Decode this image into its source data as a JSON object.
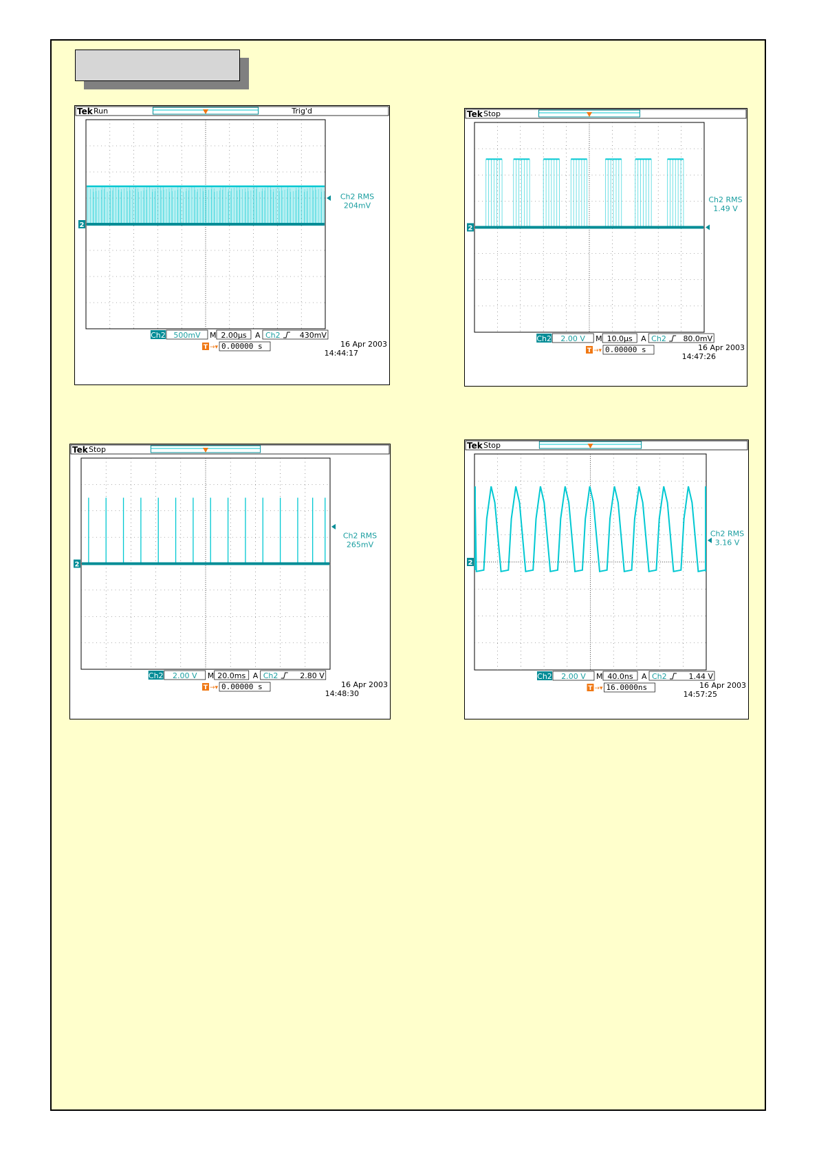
{
  "title_box_text": "",
  "colors": {
    "trace": "#00c8d2",
    "trace_dark": "#008c96",
    "marker": "#f07814",
    "label": "#1a9ea0",
    "page_bg": "#ffffcc"
  },
  "chart_data": [
    {
      "type": "line",
      "id": "scope-1",
      "brand": "Tek",
      "status": "Run",
      "trig_state": "Trig'd",
      "channel": "Ch2",
      "volts_per_div": "500mV",
      "timebase_prefix": "M",
      "timebase": "2.00µs",
      "trigger_prefix": "A",
      "trigger_channel": "Ch2",
      "trigger_slope": "rising",
      "trigger_level": "430mV",
      "trigger_offset": "0.00000 s",
      "measurement_label": "Ch2 RMS",
      "measurement_value": "204mV",
      "date": "16 Apr 2003",
      "time": "14:44:17",
      "waveform": "dense pulse train, baseline ~0 V, high level ~1.45 div"
    },
    {
      "type": "line",
      "id": "scope-2",
      "brand": "Tek",
      "status": "Stop",
      "trig_state": "",
      "channel": "Ch2",
      "volts_per_div": "2.00 V",
      "timebase_prefix": "M",
      "timebase": "10.0µs",
      "trigger_prefix": "A",
      "trigger_channel": "Ch2",
      "trigger_slope": "rising",
      "trigger_level": "80.0mV",
      "trigger_offset": "0.00000 s",
      "measurement_label": "Ch2 RMS",
      "measurement_value": "1.49 V",
      "date": "16 Apr 2003",
      "time": "14:47:26",
      "waveform": "bursts of pulses, high level ~2.6 div"
    },
    {
      "type": "line",
      "id": "scope-3",
      "brand": "Tek",
      "status": "Stop",
      "trig_state": "",
      "channel": "Ch2",
      "volts_per_div": "2.00 V",
      "timebase_prefix": "M",
      "timebase": "20.0ms",
      "trigger_prefix": "A",
      "trigger_channel": "Ch2",
      "trigger_slope": "rising",
      "trigger_level": "2.80 V",
      "trigger_offset": "0.00000 s",
      "measurement_label": "Ch2 RMS",
      "measurement_value": "265mV",
      "date": "16 Apr 2003",
      "time": "14:48:30",
      "waveform": "narrow spikes, high level ~2.5 div"
    },
    {
      "type": "line",
      "id": "scope-4",
      "brand": "Tek",
      "status": "Stop",
      "trig_state": "",
      "channel": "Ch2",
      "volts_per_div": "2.00 V",
      "timebase_prefix": "M",
      "timebase": "40.0ns",
      "trigger_prefix": "A",
      "trigger_channel": "Ch2",
      "trigger_slope": "rising",
      "trigger_level": "1.44 V",
      "trigger_offset": "16.0000ns",
      "measurement_label": "Ch2 RMS",
      "measurement_value": "3.16 V",
      "date": "16 Apr 2003",
      "time": "14:57:25",
      "waveform": "periodic sawtooth-like oscillation, -0.3 to 2.8 div"
    }
  ]
}
